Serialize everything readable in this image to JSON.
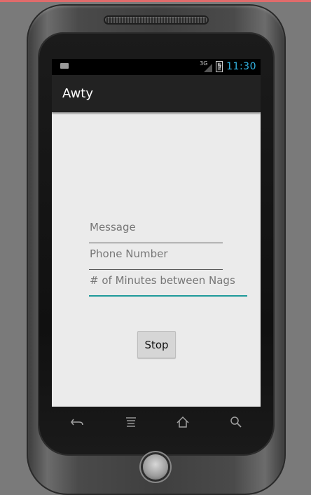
{
  "status_bar": {
    "network_label": "3G",
    "time": "11:30",
    "icons": [
      "keyboard-icon",
      "signal-icon",
      "battery-charging-icon"
    ]
  },
  "app": {
    "title": "Awty"
  },
  "form": {
    "message_placeholder": "Message",
    "phone_placeholder": "Phone Number",
    "minutes_placeholder": "# of Minutes between Nags"
  },
  "buttons": {
    "stop_label": "Stop"
  },
  "navigation": {
    "icons": [
      "back-icon",
      "menu-icon",
      "home-icon",
      "search-icon"
    ]
  },
  "colors": {
    "accent": "#33b5e5",
    "focus_underline": "#1e9a9a",
    "action_bar": "#222222",
    "screen_bg": "#ebebeb"
  }
}
